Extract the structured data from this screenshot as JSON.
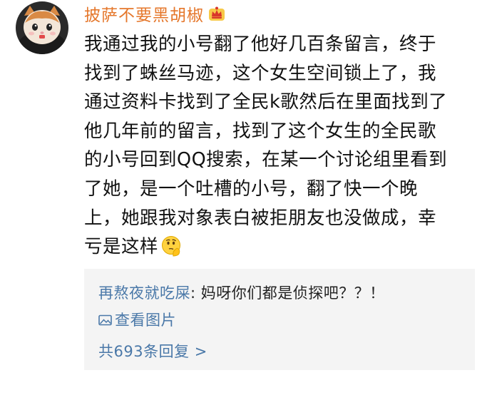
{
  "comment": {
    "username": "披萨不要黑胡椒",
    "badge_icon": "crown-icon",
    "avatar_icon": "cat-avatar",
    "lines": [
      "我通过我的小号翻了他好几百条留言，终于",
      "找到了蛛丝马迹，这个女生空间锁上了，我",
      "通过资料卡找到了全民k歌然后在里面找到了",
      "他几年前的留言，找到了这个女生的全民歌",
      "的小号回到QQ搜索，在某一个讨论组里看到",
      "了她，是一个吐槽的小号，翻了快一个晚",
      "上，她跟我对象表白被拒朋友也没做成，幸",
      "亏是这样"
    ],
    "end_emoji": "thinking-face-emoji"
  },
  "reply": {
    "author": "再熬夜就吃屎",
    "separator": ": ",
    "text": "妈呀你们都是侦探吧？？！",
    "view_image_label": "查看图片",
    "total_replies_label": "共693条回复 >"
  },
  "colors": {
    "username": "#e5772b",
    "link_blue": "#4a78a8",
    "reply_bg": "#f4f4f4",
    "text": "#111111"
  }
}
